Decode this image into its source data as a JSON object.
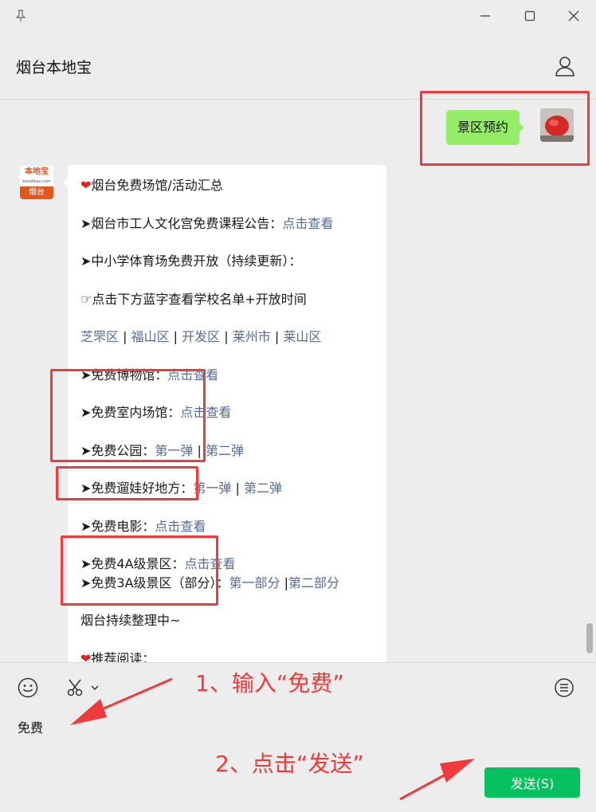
{
  "window": {
    "pin_icon": "pin-icon",
    "minimize_icon": "minimize-icon",
    "maximize_icon": "maximize-icon",
    "close_icon": "close-icon"
  },
  "header": {
    "title": "烟台本地宝",
    "profile_icon": "user-icon"
  },
  "chat": {
    "outgoing": {
      "text": "景区预约"
    },
    "bot_avatar": {
      "top_text": "本地宝",
      "small_text": "bendibao.com",
      "bottom_text": "烟台"
    },
    "message": {
      "title": "烟台免费场馆/活动汇总",
      "l1_prefix": "➤烟台市工人文化宫免费课程公告：",
      "l1_link": "点击查看",
      "l2": "➤中小学体育场免费开放（持续更新）：",
      "l3": "☞点击下方蓝字查看学校名单+开放时间",
      "districts": [
        "芝罘区",
        "福山区",
        "开发区",
        "莱州市",
        "莱山区"
      ],
      "l5_prefix": "➤免费博物馆：",
      "l5_link": "点击查看",
      "l6_prefix": "➤免费室内场馆：",
      "l6_link": "点击查看",
      "l7_prefix": "➤免费公园：",
      "l7_link1": "第一弹",
      "l7_link2": "第二弹",
      "l8_prefix": "➤免费遛娃好地方：",
      "l8_link1": "第一弹",
      "l8_link2": "第二弹",
      "l9_prefix": "➤免费电影：",
      "l9_link": "点击查看",
      "l10_prefix": "➤免费4A级景区：",
      "l10_link": "点击查看",
      "l11_prefix": "➤免费3A级景区（部分）：",
      "l11_link1": "第一部分",
      "l11_link2": "第二部分",
      "l12": "烟台持续整理中~",
      "l13": "推荐阅读："
    }
  },
  "compose": {
    "emoji_icon": "emoji-icon",
    "scissors_icon": "scissors-icon",
    "chat_history_icon": "chat-history-icon",
    "input_value": "免费",
    "send_label": "发送(S)"
  },
  "annotations": {
    "step1": "1、输入“免费”",
    "step2": "2、点击“发送”"
  },
  "colors": {
    "send_button": "#07c160",
    "outgoing_bubble": "#95ec69",
    "link": "#576b95",
    "annotation": "#ef3b3b"
  }
}
